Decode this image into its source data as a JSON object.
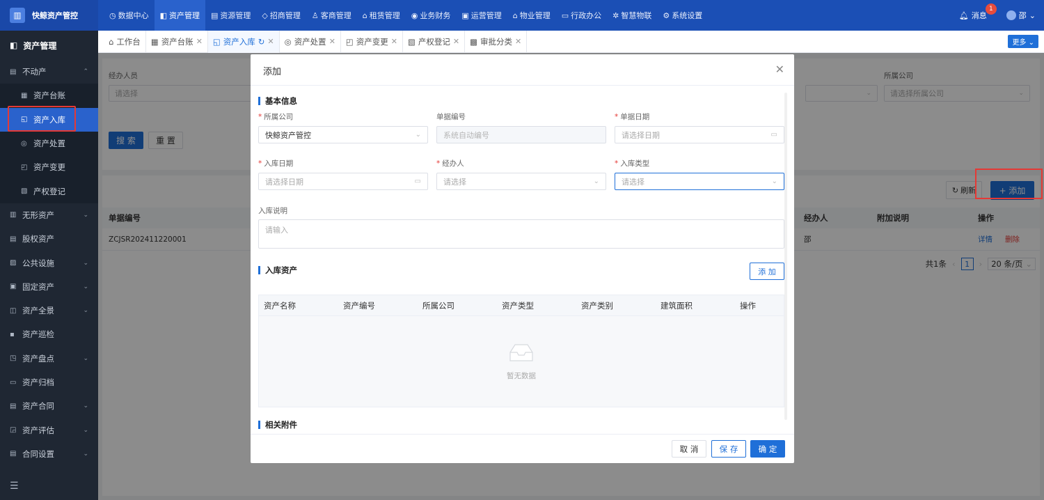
{
  "app": {
    "logo_text": "快鲸资产管控",
    "logo_icon": "building-icon"
  },
  "topnav": [
    {
      "label": "数据中心",
      "icon": "◷"
    },
    {
      "label": "资产管理",
      "icon": "◧",
      "active": true
    },
    {
      "label": "资源管理",
      "icon": "▤"
    },
    {
      "label": "招商管理",
      "icon": "◇"
    },
    {
      "label": "客商管理",
      "icon": "♙"
    },
    {
      "label": "租赁管理",
      "icon": "⌂"
    },
    {
      "label": "业务财务",
      "icon": "◉"
    },
    {
      "label": "运营管理",
      "icon": "▣"
    },
    {
      "label": "物业管理",
      "icon": "⌂"
    },
    {
      "label": "行政办公",
      "icon": "▭"
    },
    {
      "label": "智慧物联",
      "icon": "✲"
    },
    {
      "label": "系统设置",
      "icon": "⚙"
    }
  ],
  "top_right": {
    "messages_label": "消息",
    "badge": "1",
    "user_label": "邵"
  },
  "sidebar": {
    "header": "资产管理",
    "items": [
      {
        "label": "不动产",
        "icon": "▤",
        "arrow": "⌃",
        "sub": false
      },
      {
        "label": "资产台账",
        "icon": "▦",
        "sub": true
      },
      {
        "label": "资产入库",
        "icon": "◱",
        "sub": true,
        "active": true
      },
      {
        "label": "资产处置",
        "icon": "◎",
        "sub": true
      },
      {
        "label": "资产变更",
        "icon": "◰",
        "sub": true
      },
      {
        "label": "产权登记",
        "icon": "▧",
        "sub": true
      },
      {
        "label": "无形资产",
        "icon": "▥",
        "arrow": "⌄",
        "sub": false
      },
      {
        "label": "股权资产",
        "icon": "▤",
        "sub": false
      },
      {
        "label": "公共设施",
        "icon": "▨",
        "arrow": "⌄",
        "sub": false
      },
      {
        "label": "固定资产",
        "icon": "▣",
        "arrow": "⌄",
        "sub": false
      },
      {
        "label": "资产全景",
        "icon": "◫",
        "arrow": "⌄",
        "sub": false
      },
      {
        "label": "资产巡检",
        "icon": "▪",
        "sub": false
      },
      {
        "label": "资产盘点",
        "icon": "◳",
        "arrow": "⌄",
        "sub": false
      },
      {
        "label": "资产归档",
        "icon": "▭",
        "sub": false
      },
      {
        "label": "资产合同",
        "icon": "▤",
        "arrow": "⌄",
        "sub": false
      },
      {
        "label": "资产评估",
        "icon": "◲",
        "arrow": "⌄",
        "sub": false
      },
      {
        "label": "合同设置",
        "icon": "▤",
        "arrow": "⌄",
        "sub": false
      }
    ],
    "collapse_icon": "☰"
  },
  "tabs": [
    {
      "label": "工作台",
      "icon": "⌂",
      "closable": false
    },
    {
      "label": "资产台账",
      "icon": "▦",
      "closable": true
    },
    {
      "label": "资产入库",
      "icon": "◱",
      "closable": true,
      "active": true,
      "refresh": "↻"
    },
    {
      "label": "资产处置",
      "icon": "◎",
      "closable": true
    },
    {
      "label": "资产变更",
      "icon": "◰",
      "closable": true
    },
    {
      "label": "产权登记",
      "icon": "▧",
      "closable": true
    },
    {
      "label": "审批分类",
      "icon": "▩",
      "closable": true
    }
  ],
  "more_label": "更多 ⌄",
  "filter": {
    "handler_label": "经办人员",
    "handler_placeholder": "请选择",
    "company_label": "所属公司",
    "company_placeholder": "请选择所属公司",
    "search_label": "搜 索",
    "reset_label": "重 置"
  },
  "table": {
    "refresh_label": "刷新",
    "add_label": "+ 添加",
    "headers": {
      "doc_no": "单据编号",
      "handler": "经办人",
      "note": "附加说明",
      "ops": "操作"
    },
    "rows": [
      {
        "doc_no": "ZCJSR202411220001",
        "handler": "邵",
        "note": "",
        "detail": "详情",
        "delete": "删除"
      }
    ],
    "pager": {
      "total": "共1条",
      "page": "1",
      "size": "20 条/页"
    }
  },
  "dialog": {
    "title": "添加",
    "section_basic": "基本信息",
    "company_label": "所属公司",
    "company_value": "快鲸资产管控",
    "doc_no_label": "单据编号",
    "doc_no_placeholder": "系统自动编号",
    "doc_date_label": "单据日期",
    "doc_date_placeholder": "请选择日期",
    "in_date_label": "入库日期",
    "in_date_placeholder": "请选择日期",
    "handler_label": "经办人",
    "handler_placeholder": "请选择",
    "in_type_label": "入库类型",
    "in_type_placeholder": "请选择",
    "desc_label": "入库说明",
    "desc_placeholder": "请输入",
    "section_assets": "入库资产",
    "add_asset_label": "添 加",
    "asset_headers": [
      "资产名称",
      "资产编号",
      "所属公司",
      "资产类型",
      "资产类别",
      "建筑面积",
      "操作"
    ],
    "empty_text": "暂无数据",
    "section_attach": "相关附件",
    "cancel_label": "取 消",
    "save_label": "保 存",
    "ok_label": "确 定"
  },
  "colors": {
    "primary": "#1f6fd8",
    "topbar": "#1b4fb5",
    "sidebar": "#1f2733",
    "highlight": "#e53935"
  }
}
